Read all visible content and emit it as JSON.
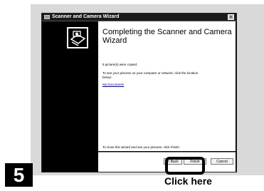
{
  "window": {
    "title": "Scanner and Camera Wizard",
    "close_label": "×"
  },
  "content": {
    "heading": "Completing the Scanner and Camera Wizard",
    "copied_text": "5 picture(s) were copied.",
    "instruction_text": "To see your pictures on your computer or network, click the location below:",
    "location_link": "My Documents",
    "close_text": "To close this wizard and see your pictures, click Finish."
  },
  "buttons": {
    "back": "< Back",
    "finish": "Finish",
    "cancel": "Cancel"
  },
  "step_number": "5",
  "caption": "Click here",
  "icons": {
    "wizard": "scanner-camera-wizard-icon"
  }
}
